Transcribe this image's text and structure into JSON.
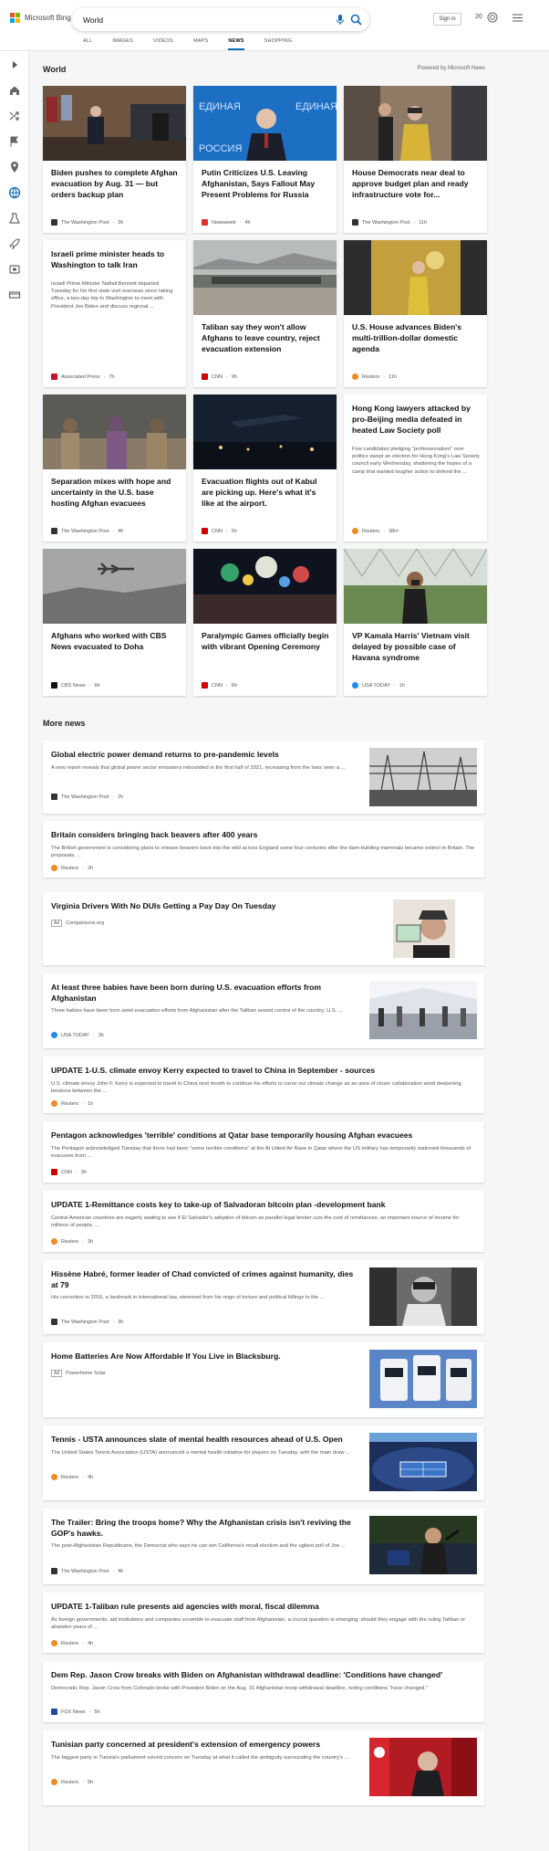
{
  "header": {
    "brand": "Microsoft Bing",
    "query": "World",
    "signin": "Sign in",
    "points": "20"
  },
  "tabs": [
    "ALL",
    "IMAGES",
    "VIDEOS",
    "MAPS",
    "NEWS",
    "SHOPPING"
  ],
  "active_tab": "NEWS",
  "section": {
    "title": "World",
    "powered": "Powered by Microsoft News"
  },
  "cards": [
    {
      "title": "Biden pushes to complete Afghan evacuation by Aug. 31 — but orders backup plan",
      "source": "The Washington Post",
      "age": "2h"
    },
    {
      "title": "Putin Criticizes U.S. Leaving Afghanistan, Says Fallout May Present Problems for Russia",
      "source": "Newsweek",
      "age": "4h"
    },
    {
      "title": "House Democrats near deal to approve budget plan and ready infrastructure vote for...",
      "source": "The Washington Post",
      "age": "11h"
    },
    {
      "title": "Israeli prime minister heads to Washington to talk Iran",
      "abstract": "Israeli Prime Minister Naftali Bennett departed Tuesday for his first state visit overseas since taking office, a two-day trip to Washington to meet with President Joe Biden and discuss regional ...",
      "source": "Associated Press",
      "age": "7h"
    },
    {
      "title": "Taliban say they won't allow Afghans to leave country, reject evacuation extension",
      "source": "CNN",
      "age": "9h"
    },
    {
      "title": "U.S. House advances Biden's multi-trillion-dollar domestic agenda",
      "source": "Reuters",
      "age": "11h"
    },
    {
      "title": "Separation mixes with hope and uncertainty in the U.S. base hosting Afghan evacuees",
      "source": "The Washington Post",
      "age": "4h"
    },
    {
      "title": "Evacuation flights out of Kabul are picking up. Here's what it's like at the airport.",
      "source": "CNN",
      "age": "5h"
    },
    {
      "title": "Hong Kong lawyers attacked by pro-Beijing media defeated in heated Law Society poll",
      "abstract": "Five candidates pledging \"professionalism\" over politics swept an election for Hong Kong's Law Society council early Wednesday, shattering the hopes of a camp that wanted tougher action to defend the ...",
      "source": "Reuters",
      "age": "38m"
    },
    {
      "title": "Afghans who worked with CBS News evacuated to Doha",
      "source": "CBS News",
      "age": "6h"
    },
    {
      "title": "Paralympic Games officially begin with vibrant Opening Ceremony",
      "source": "CNN",
      "age": "6h"
    },
    {
      "title": "VP Kamala Harris' Vietnam visit delayed by possible case of Havana syndrome",
      "source": "USA TODAY",
      "age": "1h"
    }
  ],
  "more_title": "More news",
  "more": [
    {
      "title": "Global electric power demand returns to pre-pandemic levels",
      "abstract": "A new report reveals that global power sector emissions rebounded in the first half of 2021, increasing from the lows seen a ...",
      "source": "The Washington Post",
      "age": "2h"
    },
    {
      "title": "Britain considers bringing back beavers after 400 years",
      "abstract": "The British government is considering plans to release beavers back into the wild across England some four centuries after the dam-building mammals became extinct in Britain. The proposals, ...",
      "source": "Reuters",
      "age": "2h"
    },
    {
      "title": "Virginia Drivers With No DUIs Getting a Pay Day On Tuesday",
      "ad": "Ad",
      "source": "Comparisons.org",
      "age": ""
    },
    {
      "title": "At least three babies have been born during U.S. evacuation efforts from Afghanistan",
      "abstract": "Three babies have been born amid evacuation efforts from Afghanistan after the Taliban seized control of the country, U.S. ...",
      "source": "USA TODAY",
      "age": "3h"
    },
    {
      "title": "UPDATE 1-U.S. climate envoy Kerry expected to travel to China in September - sources",
      "abstract": "U.S. climate envoy John F. Kerry is expected to travel to China next month to continue his efforts to carve out climate change as an area of closer collaboration amid deepening tensions between the ...",
      "source": "Reuters",
      "age": "1h"
    },
    {
      "title": "Pentagon acknowledges 'terrible' conditions at Qatar base temporarily housing Afghan evacuees",
      "abstract": "The Pentagon acknowledged Tuesday that there had been \"some terrible conditions\" at the Al Udeid Air Base in Qatar where the US military has temporarily stationed thousands of evacuees from ...",
      "source": "CNN",
      "age": "3h"
    },
    {
      "title": "UPDATE 1-Remittance costs key to take-up of Salvadoran bitcoin plan -development bank",
      "abstract": "Central American countries are eagerly waiting to see if El Salvador's adoption of bitcoin as parallel legal tender cuts the cost of remittances, an important source of income for millions of people, ...",
      "source": "Reuters",
      "age": "3h"
    },
    {
      "title": "Hissène Habré, former leader of Chad convicted of crimes against humanity, dies at 79",
      "abstract": "His conviction in 2016, a landmark in international law, stemmed from his reign of torture and political killings in the ...",
      "source": "The Washington Post",
      "age": "3h"
    },
    {
      "title": "Home Batteries Are Now Affordable If You Live in Blacksburg.",
      "ad": "Ad",
      "source": "Powerhome Solar",
      "age": ""
    },
    {
      "title": "Tennis - USTA announces slate of mental health resources ahead of U.S. Open",
      "abstract": "The United States Tennis Association (USTA) announced a mental health initiative for players on Tuesday, with the main draw ...",
      "source": "Reuters",
      "age": "4h"
    },
    {
      "title": "The Trailer: Bring the troops home? Why the Afghanistan crisis isn't reviving the GOP's hawks.",
      "abstract": "The post-Afghanistan Republicans, the Democrat who says he can win California's recall election and the ugliest poll of Joe ...",
      "source": "The Washington Post",
      "age": "4h"
    },
    {
      "title": "UPDATE 1-Taliban rule presents aid agencies with moral, fiscal dilemma",
      "abstract": "As foreign governments, aid institutions and companies scramble to evacuate staff from Afghanistan, a crucial question is emerging: should they engage with the ruling Taliban or abandon years of ...",
      "source": "Reuters",
      "age": "4h"
    },
    {
      "title": "Dem Rep. Jason Crow breaks with Biden on Afghanistan withdrawal deadline: 'Conditions have changed'",
      "abstract": "Democratic Rep. Jason Crow from Colorado broke with President Biden on the Aug. 31 Afghanistan troop withdrawal deadline, noting conditions \"have changed.\"",
      "source": "FOX News",
      "age": "5h"
    },
    {
      "title": "Tunisian party concerned at president's extension of emergency powers",
      "abstract": "The biggest party in Tunisia's parliament voiced concern on Tuesday at what it called the ambiguity surrounding the country's ...",
      "source": "Reuters",
      "age": "5h"
    }
  ]
}
